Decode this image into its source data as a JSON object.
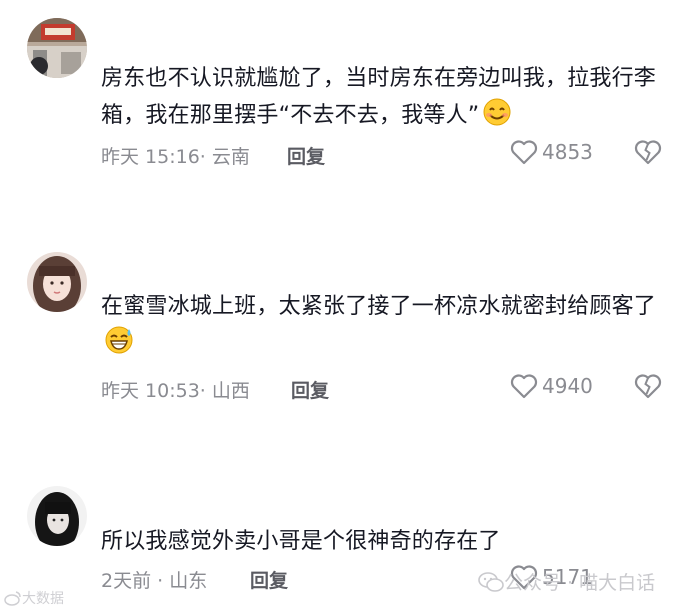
{
  "comments": [
    {
      "avatar_icon": "avatar-photo-storefront",
      "text": "房东也不认识就尴尬了，当时房东在旁边叫我，拉我行李箱，我在那里摆手“不去不去，我等人”",
      "emoji": "smiling-face-emoji",
      "time": "昨天 15:16",
      "location": "云南",
      "reply_label": "回复",
      "likes": "4853"
    },
    {
      "avatar_icon": "avatar-photo-girl",
      "text": "在蜜雪冰城上班，太紧张了接了一杯凉水就密封给顾客了",
      "emoji": "grinning-sweat-emoji",
      "time": "昨天 10:53",
      "location": "山西",
      "reply_label": "回复",
      "likes": "4940"
    },
    {
      "avatar_icon": "avatar-photo-dark-hair",
      "text": "所以我感觉外卖小哥是个很神奇的存在了",
      "time": "2天前",
      "location": "山东",
      "reply_label": "回复",
      "likes": "5171"
    }
  ],
  "watermarks": {
    "left": "大数据",
    "right": "公众号 · 喵大白话"
  },
  "colors": {
    "text": "#161823",
    "meta": "#8a8b91",
    "icon": "#8a8b91"
  }
}
